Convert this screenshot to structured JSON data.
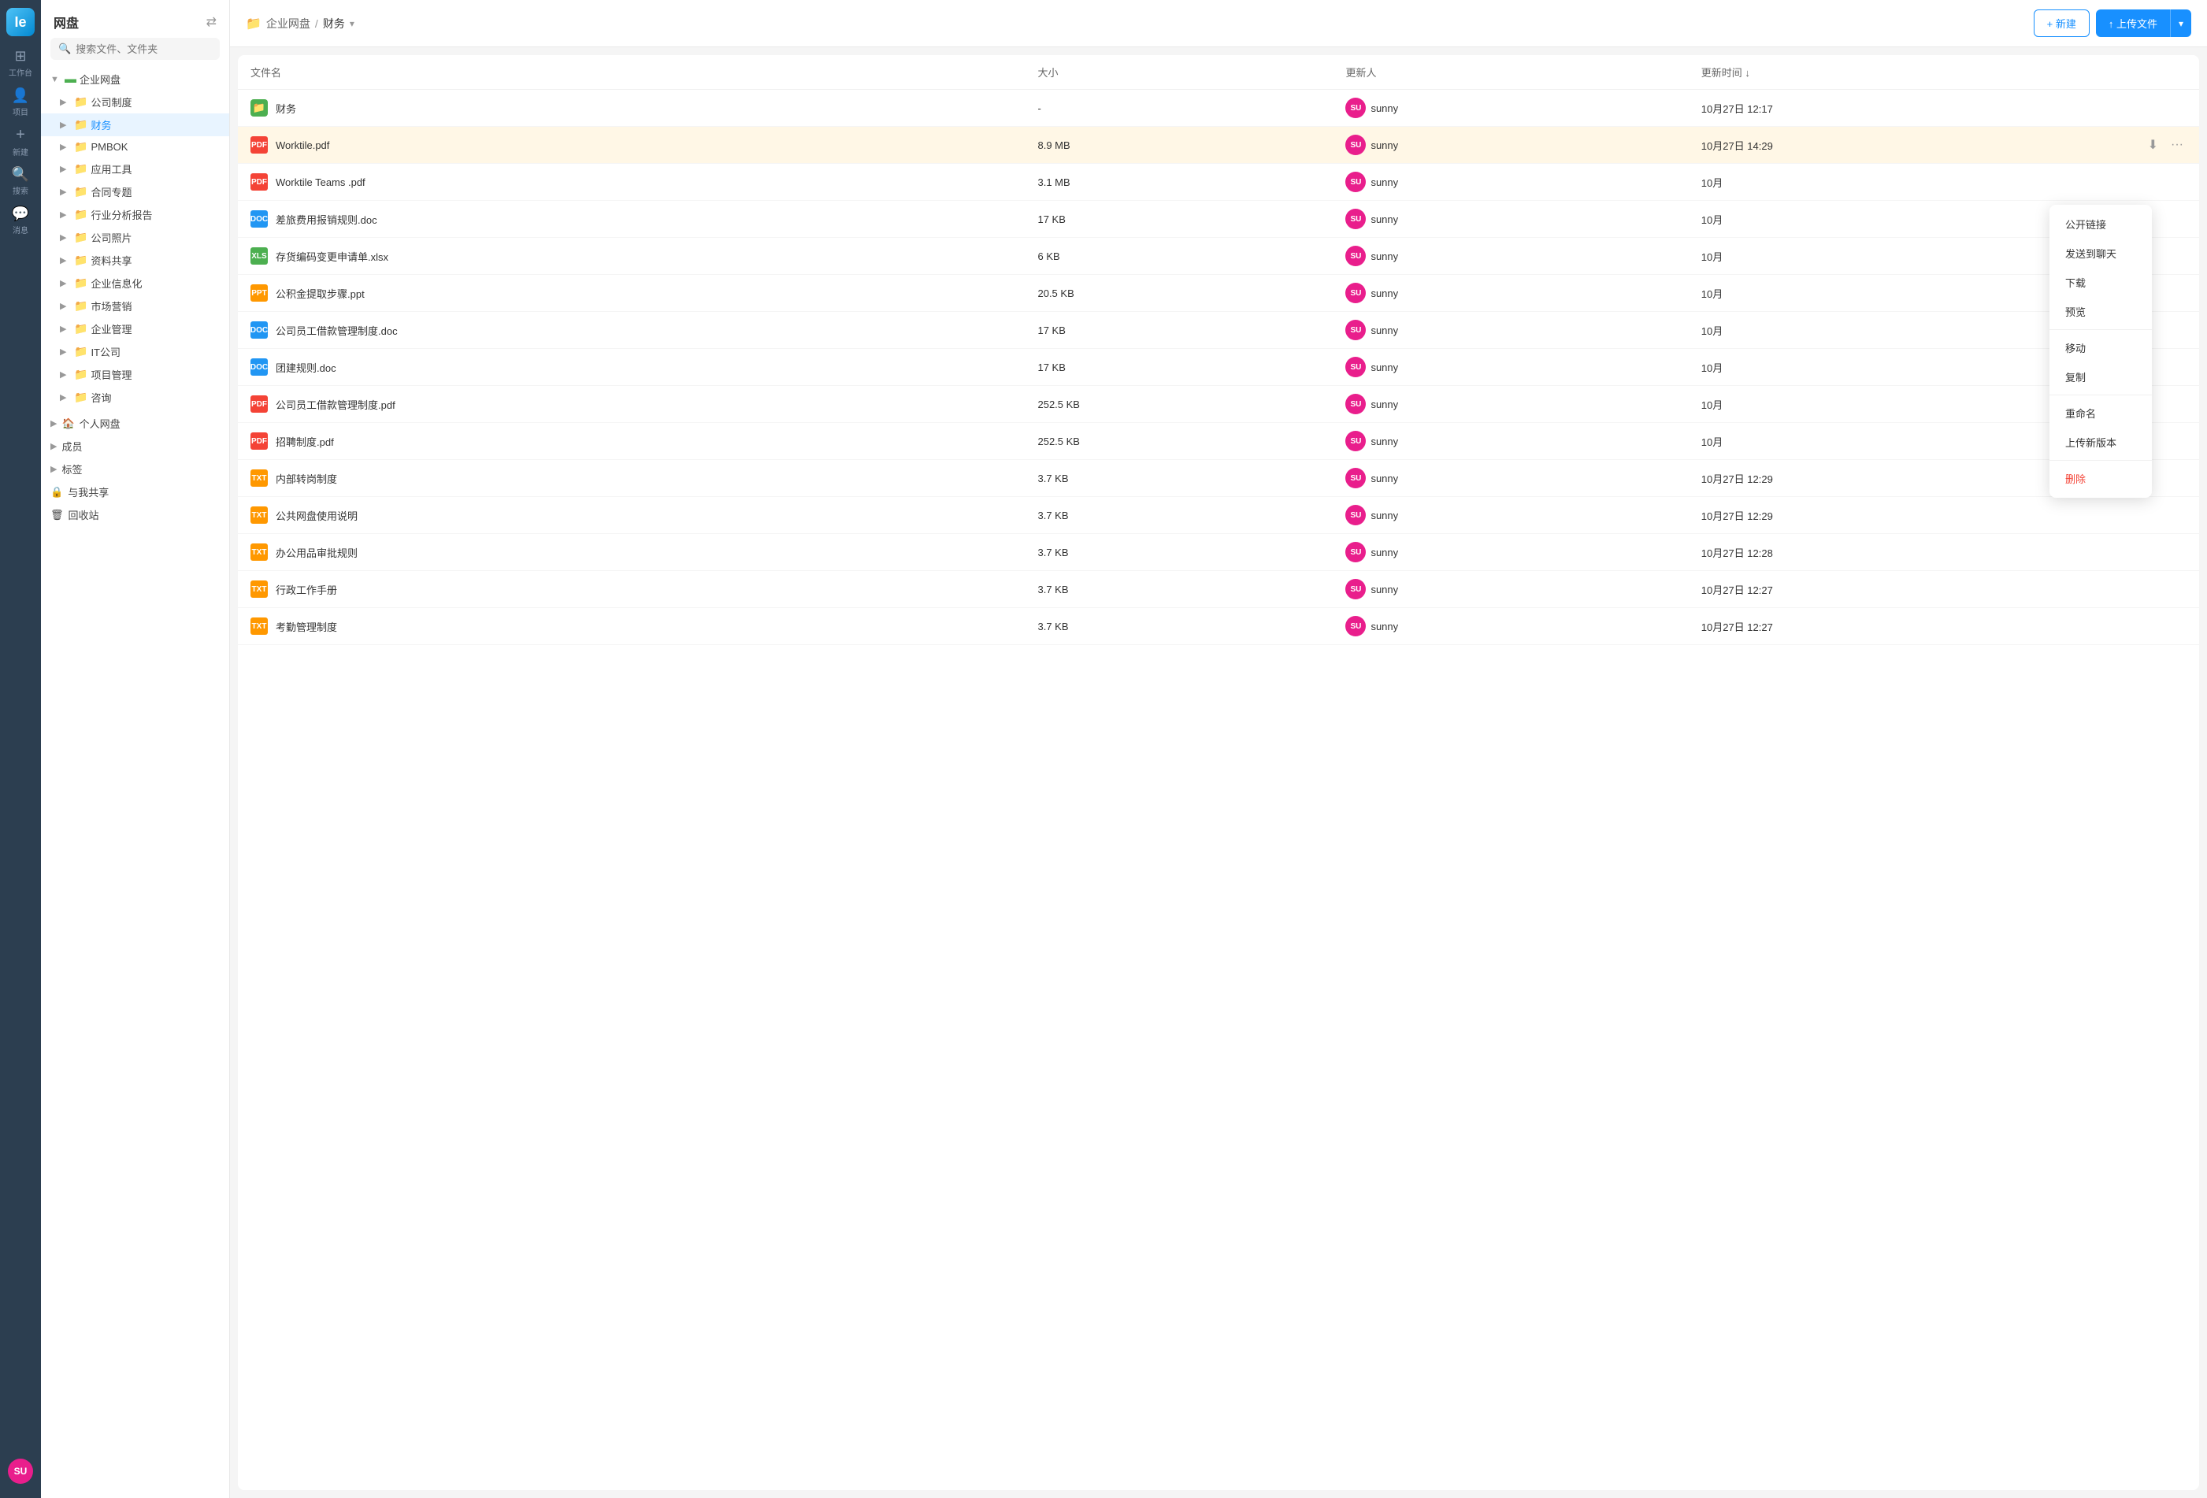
{
  "app": {
    "title": "网盘",
    "logo": "Ie"
  },
  "nav": {
    "items": [
      {
        "id": "workspace",
        "icon": "⊞",
        "label": "工作台"
      },
      {
        "id": "project",
        "icon": "👤",
        "label": "项目"
      },
      {
        "id": "new",
        "icon": "+",
        "label": "新建"
      },
      {
        "id": "search",
        "icon": "🔍",
        "label": "搜索"
      },
      {
        "id": "message",
        "icon": "💬",
        "label": "消息"
      }
    ],
    "avatar": "SU"
  },
  "sidebar": {
    "title": "网盘",
    "search_placeholder": "搜索文件、文件夹",
    "tree": [
      {
        "indent": 0,
        "expanded": true,
        "folder_color": "#4caf50",
        "label": "企业网盘"
      },
      {
        "indent": 1,
        "expanded": false,
        "folder_color": "#f06292",
        "label": "公司制度"
      },
      {
        "indent": 1,
        "expanded": true,
        "folder_color": "#4caf50",
        "label": "财务",
        "active": true
      },
      {
        "indent": 1,
        "expanded": false,
        "folder_color": "#ff9800",
        "label": "PMBOK"
      },
      {
        "indent": 1,
        "expanded": false,
        "folder_color": "#ff9800",
        "label": "应用工具"
      },
      {
        "indent": 1,
        "expanded": false,
        "folder_color": "#ff9800",
        "label": "合同专题"
      },
      {
        "indent": 1,
        "expanded": false,
        "folder_color": "#ff9800",
        "label": "行业分析报告"
      },
      {
        "indent": 1,
        "expanded": false,
        "folder_color": "#1565c0",
        "label": "公司照片"
      },
      {
        "indent": 1,
        "expanded": false,
        "folder_color": "#ff9800",
        "label": "资料共享"
      },
      {
        "indent": 1,
        "expanded": false,
        "folder_color": "#1565c0",
        "label": "企业信息化"
      },
      {
        "indent": 1,
        "expanded": false,
        "folder_color": "#66bb6a",
        "label": "市场营销"
      },
      {
        "indent": 1,
        "expanded": false,
        "folder_color": "#1565c0",
        "label": "企业管理"
      },
      {
        "indent": 1,
        "expanded": false,
        "folder_color": "#66bb6a",
        "label": "IT公司"
      },
      {
        "indent": 1,
        "expanded": false,
        "folder_color": "#ff9800",
        "label": "项目管理"
      },
      {
        "indent": 1,
        "expanded": false,
        "folder_color": "#1565c0",
        "label": "咨询"
      }
    ],
    "personal_drive": "个人网盘",
    "members": "成员",
    "tags": "标签",
    "shared": "与我共享",
    "trash": "回收站"
  },
  "breadcrumb": {
    "root": "企业网盘",
    "sep": "/",
    "current": "财务"
  },
  "toolbar": {
    "new_label": "+ 新建",
    "upload_label": "↑ 上传文件"
  },
  "table": {
    "columns": {
      "name": "文件名",
      "size": "大小",
      "updater": "更新人",
      "update_time": "更新时间 ↓"
    },
    "files": [
      {
        "id": 1,
        "type": "folder",
        "name": "财务",
        "size": "-",
        "updater": "sunny",
        "update_time": "10月27日 12:17"
      },
      {
        "id": 2,
        "type": "pdf",
        "name": "Worktile.pdf",
        "size": "8.9 MB",
        "updater": "sunny",
        "update_time": "10月27日 14:29",
        "selected": true
      },
      {
        "id": 3,
        "type": "pdf",
        "name": "Worktile Teams .pdf",
        "size": "3.1 MB",
        "updater": "sunny",
        "update_time": "10月"
      },
      {
        "id": 4,
        "type": "doc",
        "name": "差旅费用报销规则.doc",
        "size": "17 KB",
        "updater": "sunny",
        "update_time": "10月"
      },
      {
        "id": 5,
        "type": "xlsx",
        "name": "存货编码变更申请单.xlsx",
        "size": "6 KB",
        "updater": "sunny",
        "update_time": "10月"
      },
      {
        "id": 6,
        "type": "ppt",
        "name": "公积金提取步骤.ppt",
        "size": "20.5 KB",
        "updater": "sunny",
        "update_time": "10月"
      },
      {
        "id": 7,
        "type": "doc",
        "name": "公司员工借款管理制度.doc",
        "size": "17 KB",
        "updater": "sunny",
        "update_time": "10月"
      },
      {
        "id": 8,
        "type": "doc",
        "name": "团建规则.doc",
        "size": "17 KB",
        "updater": "sunny",
        "update_time": "10月"
      },
      {
        "id": 9,
        "type": "pdf",
        "name": "公司员工借款管理制度.pdf",
        "size": "252.5 KB",
        "updater": "sunny",
        "update_time": "10月"
      },
      {
        "id": 10,
        "type": "pdf",
        "name": "招聘制度.pdf",
        "size": "252.5 KB",
        "updater": "sunny",
        "update_time": "10月"
      },
      {
        "id": 11,
        "type": "txt",
        "name": "内部转岗制度",
        "size": "3.7 KB",
        "updater": "sunny",
        "update_time": "10月27日 12:29"
      },
      {
        "id": 12,
        "type": "txt",
        "name": "公共网盘使用说明",
        "size": "3.7 KB",
        "updater": "sunny",
        "update_time": "10月27日 12:29"
      },
      {
        "id": 13,
        "type": "txt",
        "name": "办公用品审批规则",
        "size": "3.7 KB",
        "updater": "sunny",
        "update_time": "10月27日 12:28"
      },
      {
        "id": 14,
        "type": "txt",
        "name": "行政工作手册",
        "size": "3.7 KB",
        "updater": "sunny",
        "update_time": "10月27日 12:27"
      },
      {
        "id": 15,
        "type": "txt",
        "name": "考勤管理制度",
        "size": "3.7 KB",
        "updater": "sunny",
        "update_time": "10月27日 12:27"
      }
    ]
  },
  "context_menu": {
    "items": [
      {
        "id": "public-link",
        "label": "公开链接"
      },
      {
        "id": "send-chat",
        "label": "发送到聊天"
      },
      {
        "id": "download",
        "label": "下载"
      },
      {
        "id": "preview",
        "label": "预览"
      },
      {
        "id": "move",
        "label": "移动"
      },
      {
        "id": "copy",
        "label": "复制"
      },
      {
        "id": "rename",
        "label": "重命名"
      },
      {
        "id": "upload-new-version",
        "label": "上传新版本"
      },
      {
        "id": "delete",
        "label": "删除",
        "danger": true
      }
    ]
  },
  "icons": {
    "expand": "▶",
    "collapse": "▼",
    "folder_green": "🟩",
    "download": "⬇",
    "more": "•••",
    "search": "🔍",
    "chevron_down": "▾"
  }
}
